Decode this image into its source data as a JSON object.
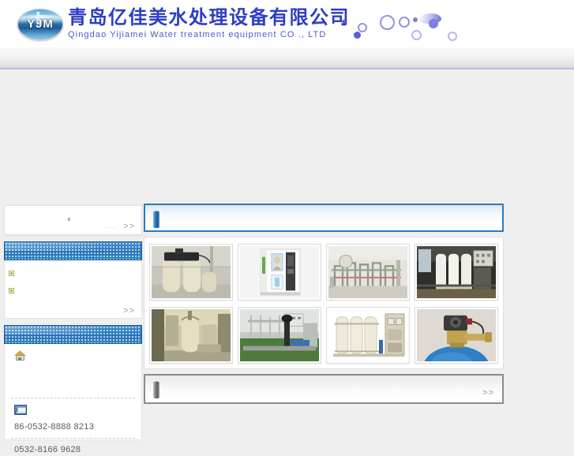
{
  "header": {
    "logo_text": "YJM",
    "logo_alt": "yjm-water-logo",
    "company_cn": "青岛亿佳美水处理设备有限公司",
    "company_en": "Qingdao Yijiamei Water treatment equipment CO ., LTD"
  },
  "sidebar": {
    "search_box": {
      "faint_text": "......",
      "more_label": ">>"
    },
    "nav_panel": {
      "title": "",
      "items": [
        {
          "label": ""
        },
        {
          "label": ""
        }
      ],
      "more_label": ">>"
    },
    "contact_panel": {
      "title": "",
      "address_label": "",
      "phone_1": "86-0532-8888 8213",
      "phone_2": "0532-8166 9628"
    }
  },
  "main": {
    "products_panel": {
      "title": "",
      "marker": "blue-bar-marker"
    },
    "gallery": {
      "rows": [
        [
          {
            "alt": "water-softener-twin-tanks"
          },
          {
            "alt": "water-vending-machine"
          },
          {
            "alt": "industrial-piping-plant"
          },
          {
            "alt": "ro-membrane-skid"
          }
        ],
        [
          {
            "alt": "filtration-room-tank"
          },
          {
            "alt": "ro-system-green-floor"
          },
          {
            "alt": "three-tank-filter-unit"
          },
          {
            "alt": "blue-tank-valve-head"
          }
        ]
      ]
    },
    "news_panel": {
      "title": "",
      "marker": "gray-bar-marker",
      "more_label": ">>"
    }
  },
  "colors": {
    "brand_blue": "#2c3fc4",
    "link_blue": "#4a5ad8",
    "panel_blue": "#2a7ac2",
    "panel_gray": "#8c8c8c",
    "bubble_blue": "#5a5fd6",
    "page_bg": "#efefef",
    "bullet_olive": "#b0ae58"
  }
}
